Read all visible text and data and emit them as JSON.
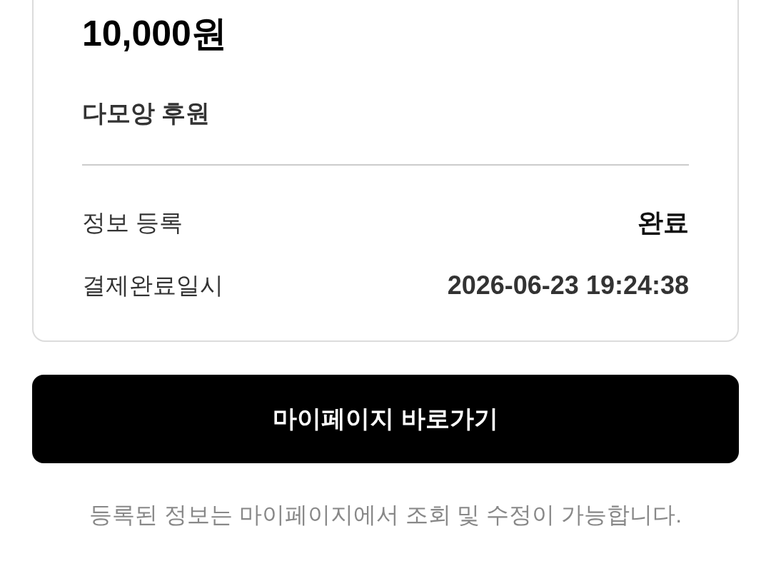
{
  "payment": {
    "amount": "10,000원",
    "description": "다모앙 후원",
    "details": [
      {
        "label": "정보 등록",
        "value": "완료"
      },
      {
        "label": "결제완료일시",
        "value": "2026-06-23 19:24:38"
      }
    ]
  },
  "primary_button": {
    "label": "마이페이지 바로가기"
  },
  "footer_note": "등록된 정보는 마이페이지에서 조회 및 수정이 가능합니다."
}
